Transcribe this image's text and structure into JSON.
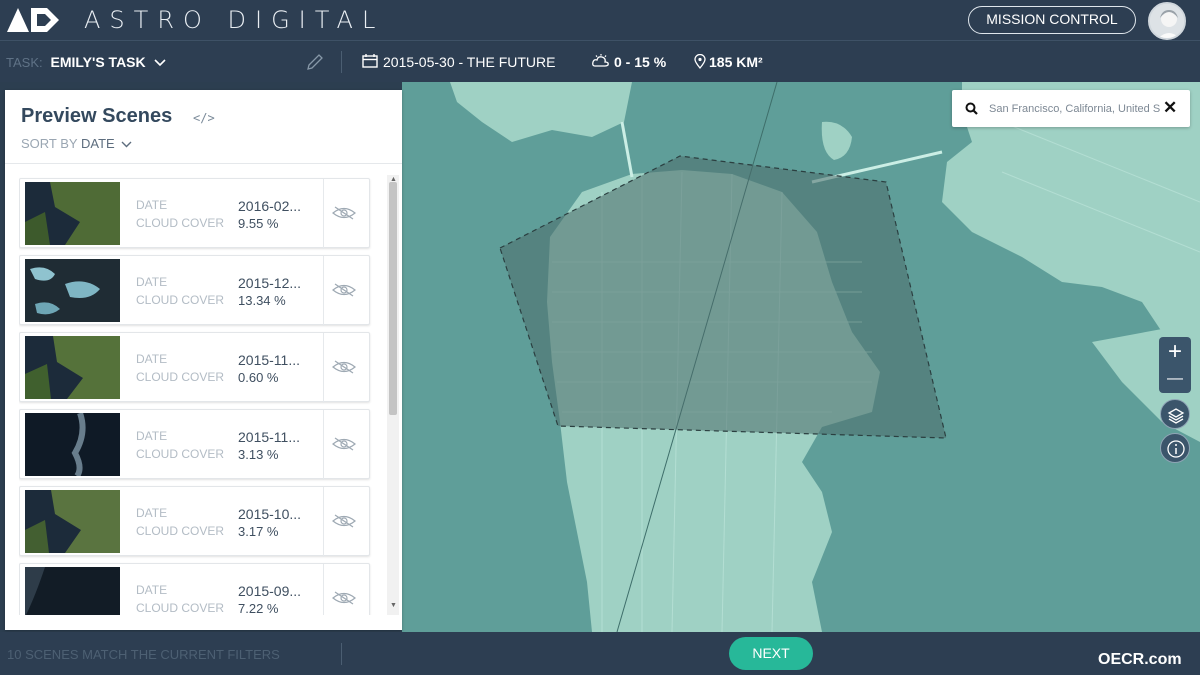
{
  "header": {
    "brand": "ASTRO DIGITAL",
    "mission_control_label": "MISSION CONTROL"
  },
  "taskbar": {
    "task_prefix": "TASK:",
    "task_name": "EMILY'S TASK",
    "date_range": "2015-05-30 - THE FUTURE",
    "cloud_range": "0 - 15 %",
    "area": "185 KM²"
  },
  "panel": {
    "title": "Preview Scenes",
    "sort_prefix": "SORT BY",
    "sort_value": "DATE",
    "date_label": "DATE",
    "cloud_label": "CLOUD COVER",
    "scenes": [
      {
        "date": "2016-02...",
        "cloud": "9.55 %"
      },
      {
        "date": "2015-12...",
        "cloud": "13.34 %"
      },
      {
        "date": "2015-11...",
        "cloud": "0.60 %"
      },
      {
        "date": "2015-11...",
        "cloud": "3.13 %"
      },
      {
        "date": "2015-10...",
        "cloud": "3.17 %"
      },
      {
        "date": "2015-09...",
        "cloud": "7.22 %"
      }
    ]
  },
  "map": {
    "search_value": "San Francisco, California, United S",
    "zoom_in": "+",
    "zoom_out": "—"
  },
  "footer": {
    "match_text": "10 SCENES MATCH THE CURRENT FILTERS",
    "next_label": "NEXT",
    "watermark": "OECR.com"
  },
  "colors": {
    "header_bg": "#2d3e52",
    "water": "#5f9e99",
    "land": "#9fd1c4",
    "accent": "#27b899"
  }
}
